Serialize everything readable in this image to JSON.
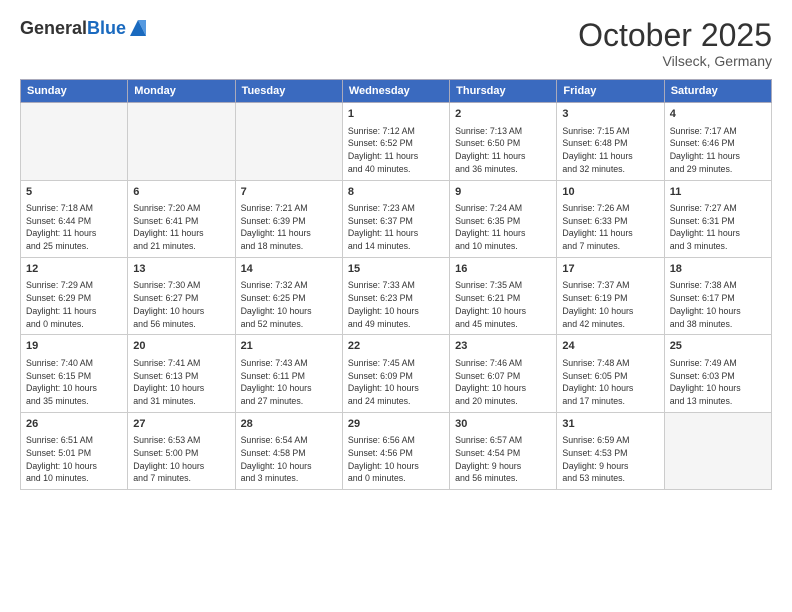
{
  "header": {
    "logo_general": "General",
    "logo_blue": "Blue",
    "month": "October 2025",
    "location": "Vilseck, Germany"
  },
  "days_of_week": [
    "Sunday",
    "Monday",
    "Tuesday",
    "Wednesday",
    "Thursday",
    "Friday",
    "Saturday"
  ],
  "weeks": [
    [
      {
        "day": "",
        "info": ""
      },
      {
        "day": "",
        "info": ""
      },
      {
        "day": "",
        "info": ""
      },
      {
        "day": "1",
        "info": "Sunrise: 7:12 AM\nSunset: 6:52 PM\nDaylight: 11 hours\nand 40 minutes."
      },
      {
        "day": "2",
        "info": "Sunrise: 7:13 AM\nSunset: 6:50 PM\nDaylight: 11 hours\nand 36 minutes."
      },
      {
        "day": "3",
        "info": "Sunrise: 7:15 AM\nSunset: 6:48 PM\nDaylight: 11 hours\nand 32 minutes."
      },
      {
        "day": "4",
        "info": "Sunrise: 7:17 AM\nSunset: 6:46 PM\nDaylight: 11 hours\nand 29 minutes."
      }
    ],
    [
      {
        "day": "5",
        "info": "Sunrise: 7:18 AM\nSunset: 6:44 PM\nDaylight: 11 hours\nand 25 minutes."
      },
      {
        "day": "6",
        "info": "Sunrise: 7:20 AM\nSunset: 6:41 PM\nDaylight: 11 hours\nand 21 minutes."
      },
      {
        "day": "7",
        "info": "Sunrise: 7:21 AM\nSunset: 6:39 PM\nDaylight: 11 hours\nand 18 minutes."
      },
      {
        "day": "8",
        "info": "Sunrise: 7:23 AM\nSunset: 6:37 PM\nDaylight: 11 hours\nand 14 minutes."
      },
      {
        "day": "9",
        "info": "Sunrise: 7:24 AM\nSunset: 6:35 PM\nDaylight: 11 hours\nand 10 minutes."
      },
      {
        "day": "10",
        "info": "Sunrise: 7:26 AM\nSunset: 6:33 PM\nDaylight: 11 hours\nand 7 minutes."
      },
      {
        "day": "11",
        "info": "Sunrise: 7:27 AM\nSunset: 6:31 PM\nDaylight: 11 hours\nand 3 minutes."
      }
    ],
    [
      {
        "day": "12",
        "info": "Sunrise: 7:29 AM\nSunset: 6:29 PM\nDaylight: 11 hours\nand 0 minutes."
      },
      {
        "day": "13",
        "info": "Sunrise: 7:30 AM\nSunset: 6:27 PM\nDaylight: 10 hours\nand 56 minutes."
      },
      {
        "day": "14",
        "info": "Sunrise: 7:32 AM\nSunset: 6:25 PM\nDaylight: 10 hours\nand 52 minutes."
      },
      {
        "day": "15",
        "info": "Sunrise: 7:33 AM\nSunset: 6:23 PM\nDaylight: 10 hours\nand 49 minutes."
      },
      {
        "day": "16",
        "info": "Sunrise: 7:35 AM\nSunset: 6:21 PM\nDaylight: 10 hours\nand 45 minutes."
      },
      {
        "day": "17",
        "info": "Sunrise: 7:37 AM\nSunset: 6:19 PM\nDaylight: 10 hours\nand 42 minutes."
      },
      {
        "day": "18",
        "info": "Sunrise: 7:38 AM\nSunset: 6:17 PM\nDaylight: 10 hours\nand 38 minutes."
      }
    ],
    [
      {
        "day": "19",
        "info": "Sunrise: 7:40 AM\nSunset: 6:15 PM\nDaylight: 10 hours\nand 35 minutes."
      },
      {
        "day": "20",
        "info": "Sunrise: 7:41 AM\nSunset: 6:13 PM\nDaylight: 10 hours\nand 31 minutes."
      },
      {
        "day": "21",
        "info": "Sunrise: 7:43 AM\nSunset: 6:11 PM\nDaylight: 10 hours\nand 27 minutes."
      },
      {
        "day": "22",
        "info": "Sunrise: 7:45 AM\nSunset: 6:09 PM\nDaylight: 10 hours\nand 24 minutes."
      },
      {
        "day": "23",
        "info": "Sunrise: 7:46 AM\nSunset: 6:07 PM\nDaylight: 10 hours\nand 20 minutes."
      },
      {
        "day": "24",
        "info": "Sunrise: 7:48 AM\nSunset: 6:05 PM\nDaylight: 10 hours\nand 17 minutes."
      },
      {
        "day": "25",
        "info": "Sunrise: 7:49 AM\nSunset: 6:03 PM\nDaylight: 10 hours\nand 13 minutes."
      }
    ],
    [
      {
        "day": "26",
        "info": "Sunrise: 6:51 AM\nSunset: 5:01 PM\nDaylight: 10 hours\nand 10 minutes."
      },
      {
        "day": "27",
        "info": "Sunrise: 6:53 AM\nSunset: 5:00 PM\nDaylight: 10 hours\nand 7 minutes."
      },
      {
        "day": "28",
        "info": "Sunrise: 6:54 AM\nSunset: 4:58 PM\nDaylight: 10 hours\nand 3 minutes."
      },
      {
        "day": "29",
        "info": "Sunrise: 6:56 AM\nSunset: 4:56 PM\nDaylight: 10 hours\nand 0 minutes."
      },
      {
        "day": "30",
        "info": "Sunrise: 6:57 AM\nSunset: 4:54 PM\nDaylight: 9 hours\nand 56 minutes."
      },
      {
        "day": "31",
        "info": "Sunrise: 6:59 AM\nSunset: 4:53 PM\nDaylight: 9 hours\nand 53 minutes."
      },
      {
        "day": "",
        "info": ""
      }
    ]
  ]
}
